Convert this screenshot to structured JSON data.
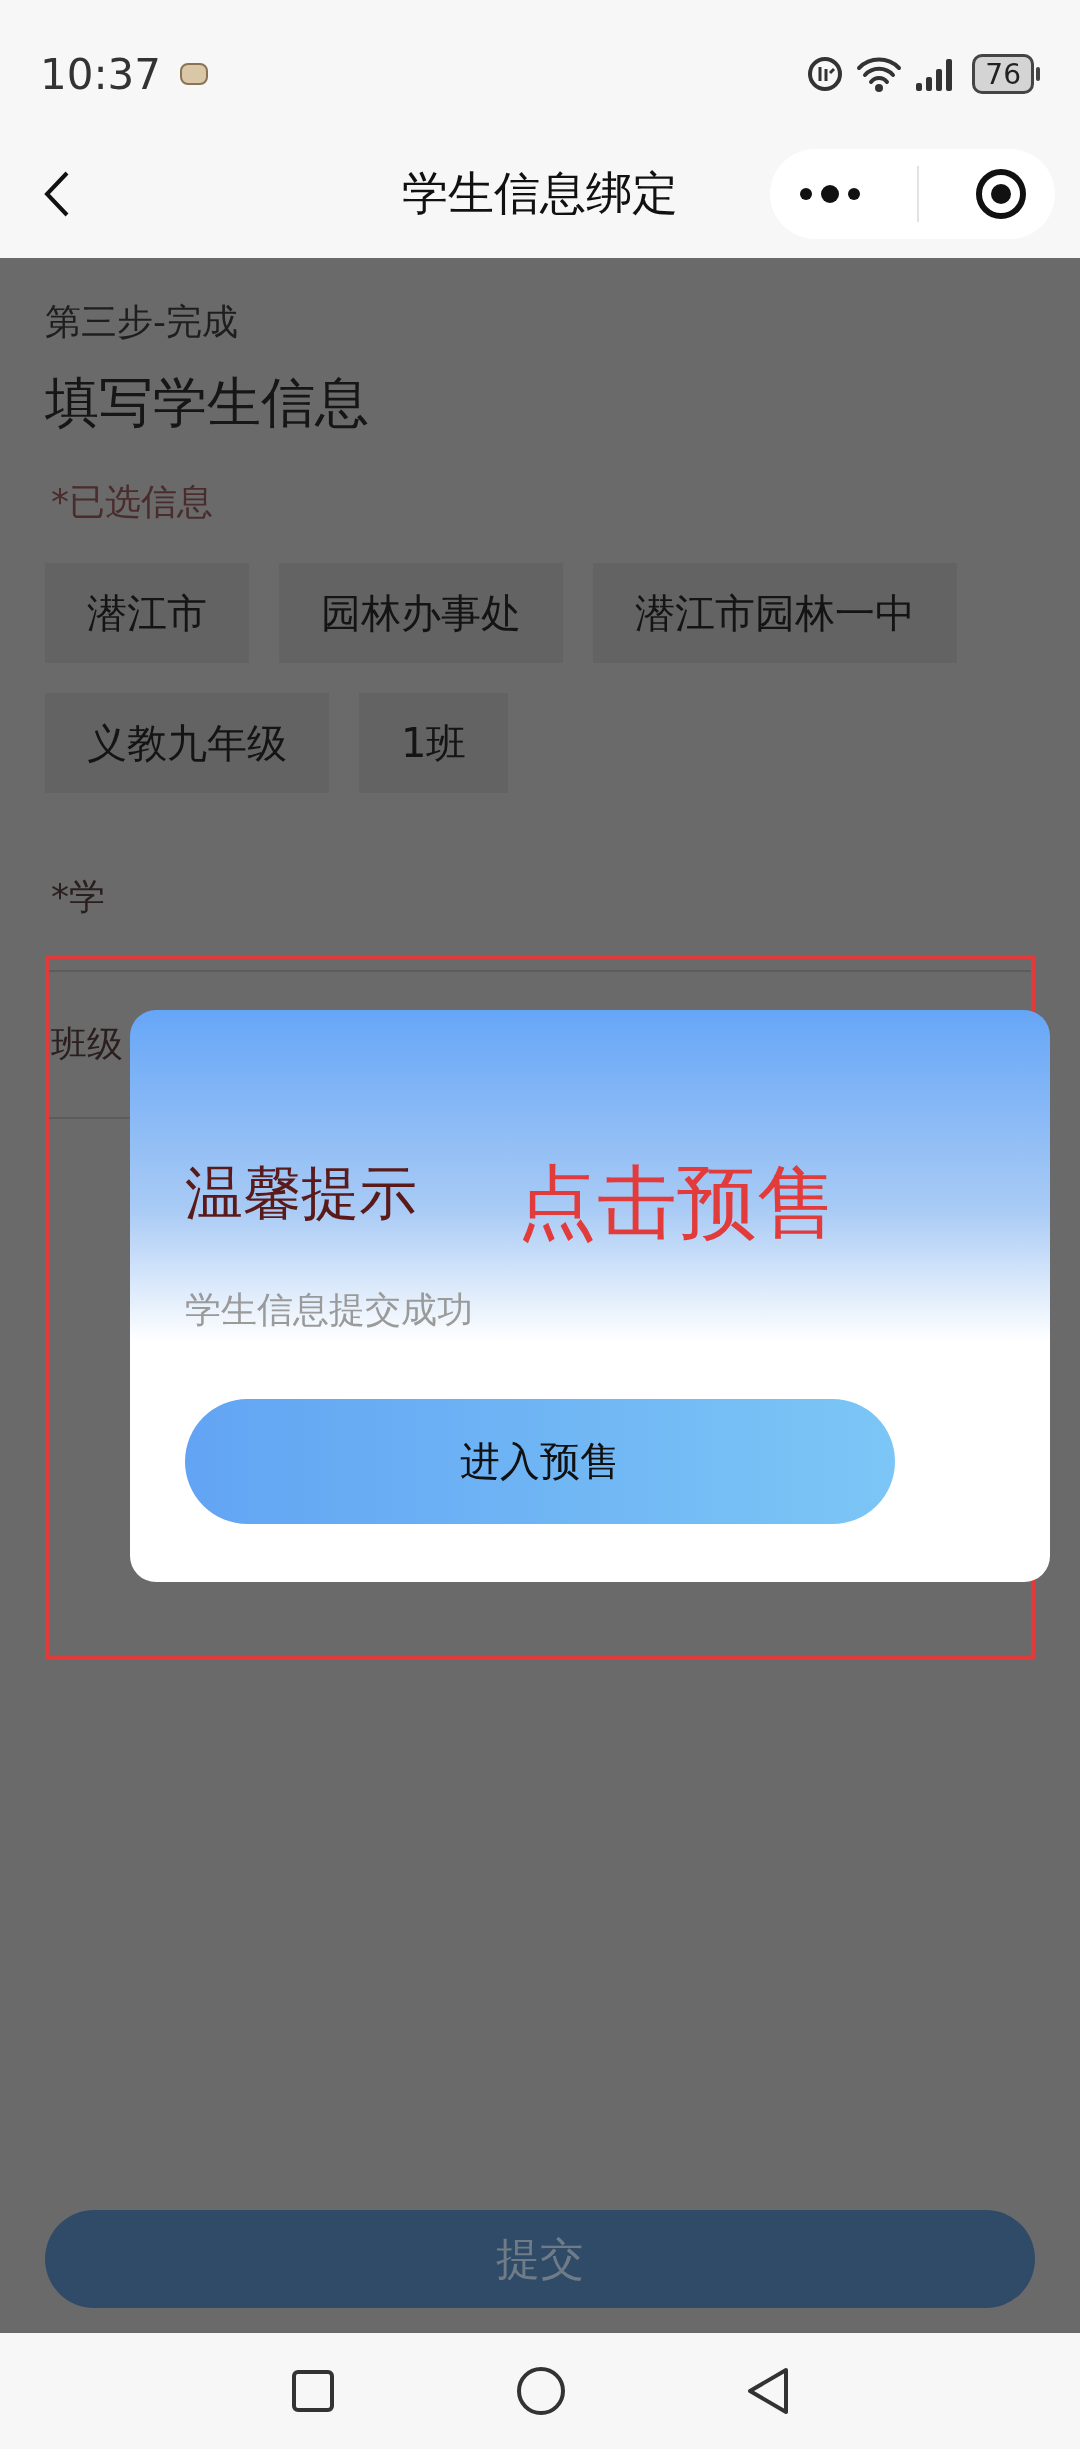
{
  "status_bar": {
    "time": "10:37",
    "battery": "76"
  },
  "nav": {
    "title": "学生信息绑定"
  },
  "page": {
    "step": "第三步-完成",
    "heading": "填写学生信息",
    "selected_label": "*已选信息",
    "chips": [
      "潜江市",
      "园林办事处",
      "潜江市园林一中",
      "义教九年级",
      "1班"
    ],
    "fields": [
      {
        "label": "*学"
      },
      {
        "label": "班级"
      }
    ]
  },
  "dialog": {
    "title": "温馨提示",
    "message": "学生信息提交成功",
    "button": "进入预售"
  },
  "annotation": {
    "text": "点击预售"
  },
  "submit_button": "提交"
}
